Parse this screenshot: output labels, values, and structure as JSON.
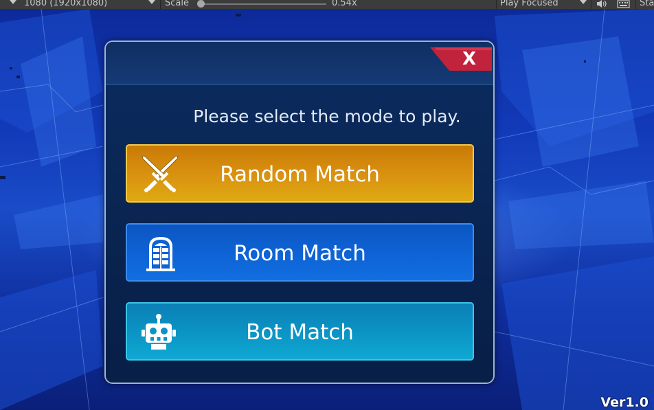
{
  "toolbar": {
    "resolution": "1080 (1920x1080)",
    "scale_label": "Scale",
    "scale_value": "0.54x",
    "play_mode": "Play Focused",
    "stats_label": "Sta"
  },
  "dialog": {
    "close_label": "X",
    "prompt": "Please select the mode to play.",
    "buttons": [
      {
        "label": "Random Match",
        "icon": "crossed-swords-icon"
      },
      {
        "label": "Room Match",
        "icon": "door-icon"
      },
      {
        "label": "Bot Match",
        "icon": "robot-icon"
      }
    ]
  },
  "version": "Ver1.0",
  "colors": {
    "random_match": "#d99010",
    "room_match": "#0e62d4",
    "bot_match": "#0b93c4",
    "close_tab": "#c0233b",
    "dialog_bg": "#0a2552"
  }
}
